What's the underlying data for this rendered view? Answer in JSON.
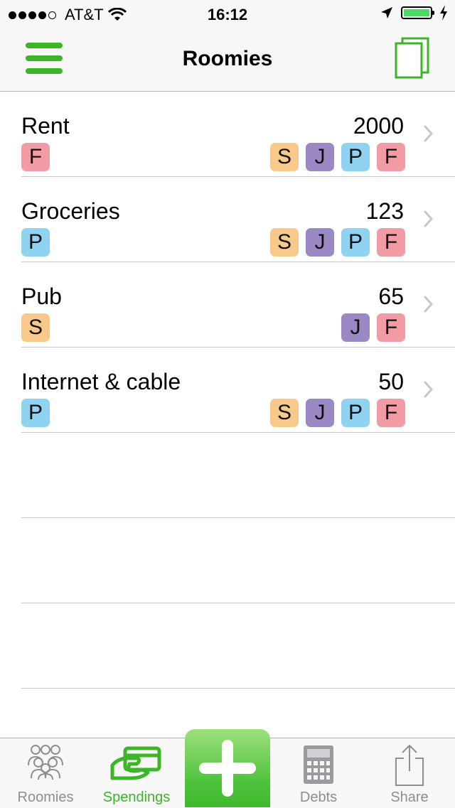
{
  "status": {
    "carrier": "AT&T",
    "time": "16:12",
    "signal_bars": 4,
    "battery_level": 1.0
  },
  "nav": {
    "title": "Roomies",
    "menu_icon": "hamburger-menu-icon",
    "copy_icon": "copy-icon"
  },
  "colors": {
    "accent": "#3cb526",
    "S": "#f8c98a",
    "J": "#9b89c5",
    "P": "#8fd2f2",
    "F": "#f19ca4"
  },
  "spendings": [
    {
      "name": "Rent",
      "amount": "2000",
      "payer": "F",
      "members": [
        "S",
        "J",
        "P",
        "F"
      ]
    },
    {
      "name": "Groceries",
      "amount": "123",
      "payer": "P",
      "members": [
        "S",
        "J",
        "P",
        "F"
      ]
    },
    {
      "name": "Pub",
      "amount": "65",
      "payer": "S",
      "members": [
        "J",
        "F"
      ]
    },
    {
      "name": "Internet & cable",
      "amount": "50",
      "payer": "P",
      "members": [
        "S",
        "J",
        "P",
        "F"
      ]
    }
  ],
  "tabs": [
    {
      "label": "Roomies",
      "icon": "people-icon",
      "active": false
    },
    {
      "label": "Spendings",
      "icon": "payment-card-icon",
      "active": true
    },
    {
      "label": "Debts",
      "icon": "calculator-icon",
      "active": false
    },
    {
      "label": "Share",
      "icon": "share-icon",
      "active": false
    }
  ],
  "add_button": {
    "icon": "plus-icon"
  }
}
